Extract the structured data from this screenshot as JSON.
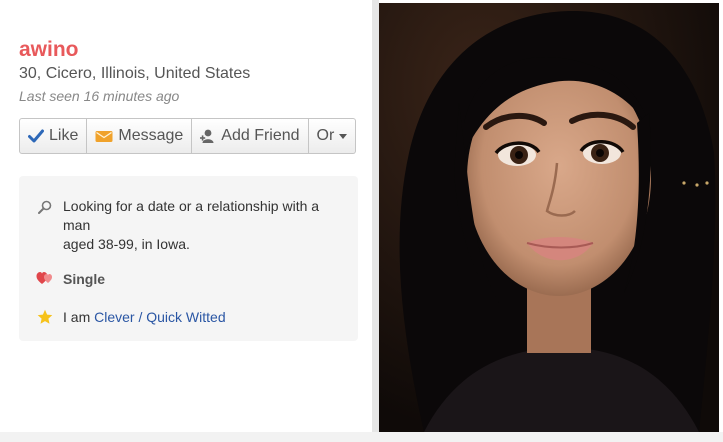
{
  "profile": {
    "name": "awino",
    "location": "30, Cicero, Illinois, United States",
    "last_seen": "Last seen 16 minutes ago"
  },
  "actions": {
    "like": "Like",
    "message": "Message",
    "add_friend": "Add Friend",
    "more": "Or"
  },
  "details": {
    "looking_line1": "Looking for a date or a relationship with a man",
    "looking_line2": "aged 38-99, in Iowa.",
    "status": "Single",
    "personality_prefix": "I am",
    "personality_value": "Clever / Quick Witted"
  },
  "icons": {
    "like": "check-icon",
    "message": "envelope-icon",
    "add_friend": "person-add-icon",
    "more": "caret-down-icon",
    "looking": "magnifier-icon",
    "status": "hearts-icon",
    "personality": "star-icon"
  },
  "colors": {
    "name": "#e8595b",
    "link": "#2a56a4",
    "check": "#2d68b8",
    "envelope": "#f0a22b",
    "hearts": "#e0464b",
    "star": "#f6c21b"
  }
}
